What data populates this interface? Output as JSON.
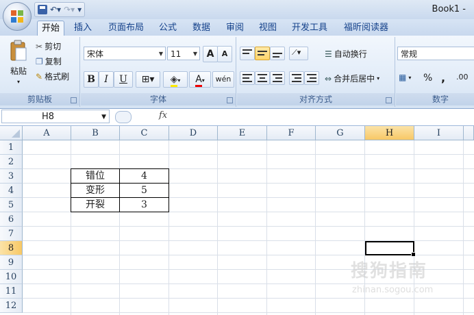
{
  "window": {
    "title": "Book1 -"
  },
  "tabs": [
    {
      "label": "开始",
      "active": true
    },
    {
      "label": "插入"
    },
    {
      "label": "页面布局"
    },
    {
      "label": "公式"
    },
    {
      "label": "数据"
    },
    {
      "label": "审阅"
    },
    {
      "label": "视图"
    },
    {
      "label": "开发工具"
    },
    {
      "label": "福昕阅读器"
    }
  ],
  "clipboard": {
    "paste": "粘贴",
    "cut": "剪切",
    "copy": "复制",
    "format_painter": "格式刷",
    "group_label": "剪贴板"
  },
  "font": {
    "name": "宋体",
    "size": "11",
    "grow": "A",
    "shrink": "A",
    "bold": "B",
    "italic": "I",
    "underline": "U",
    "font_color": "A",
    "phonetic": "wén",
    "group_label": "字体"
  },
  "alignment": {
    "wrap_text": "自动换行",
    "merge_center": "合并后居中",
    "group_label": "对齐方式"
  },
  "number": {
    "format": "常规",
    "percent": "%",
    "comma": ",",
    "decimal": ".00",
    "group_label": "数字"
  },
  "formula_bar": {
    "name_box": "H8",
    "fx": "fx",
    "content": ""
  },
  "grid": {
    "columns": [
      "A",
      "B",
      "C",
      "D",
      "E",
      "F",
      "G",
      "H",
      "I"
    ],
    "rows": [
      "1",
      "2",
      "3",
      "4",
      "5",
      "6",
      "7",
      "8",
      "9",
      "10",
      "11",
      "12"
    ],
    "selected_col": "H",
    "selected_row": "8",
    "table": [
      {
        "label": "错位",
        "value": "4"
      },
      {
        "label": "变形",
        "value": "5"
      },
      {
        "label": "开裂",
        "value": "3"
      }
    ]
  },
  "watermark": {
    "text": "搜狗指南",
    "url": "zhinan.sogou.com"
  },
  "colors": {
    "ribbon": "#dfe9f5",
    "selected_header": "#f8c865",
    "accent": "#15428b"
  }
}
